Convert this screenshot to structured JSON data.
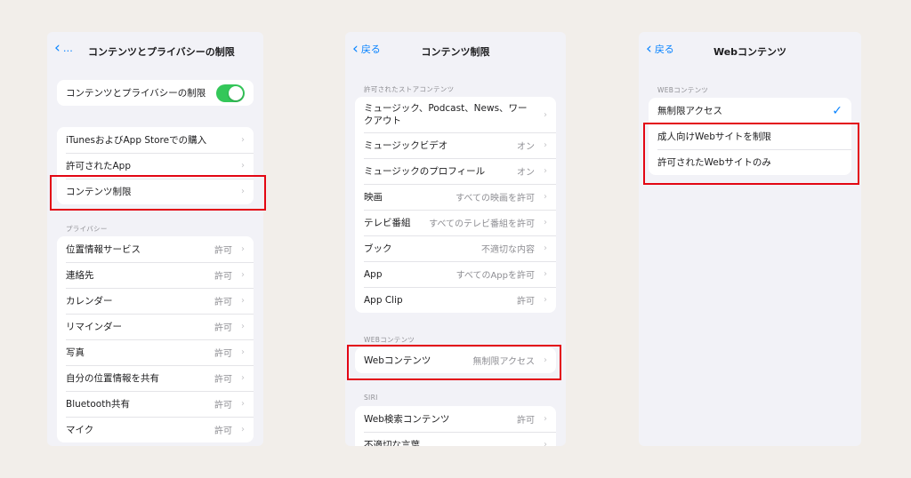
{
  "screen1": {
    "back_label": "…",
    "title": "コンテンツとプライバシーの制限",
    "toggle_row": {
      "label": "コンテンツとプライバシーの制限",
      "on": true
    },
    "group1": [
      {
        "label": "iTunesおよびApp Storeでの購入"
      },
      {
        "label": "許可されたApp"
      },
      {
        "label": "コンテンツ制限"
      }
    ],
    "privacy_header": "プライバシー",
    "privacy_rows": [
      {
        "label": "位置情報サービス",
        "value": "許可"
      },
      {
        "label": "連絡先",
        "value": "許可"
      },
      {
        "label": "カレンダー",
        "value": "許可"
      },
      {
        "label": "リマインダー",
        "value": "許可"
      },
      {
        "label": "写真",
        "value": "許可"
      },
      {
        "label": "自分の位置情報を共有",
        "value": "許可"
      },
      {
        "label": "Bluetooth共有",
        "value": "許可"
      },
      {
        "label": "マイク",
        "value": "許可"
      }
    ]
  },
  "screen2": {
    "back_label": "戻る",
    "title": "コンテンツ制限",
    "store_header": "許可されたストアコンテンツ",
    "store_rows": [
      {
        "label": "ミュージック、Podcast、News、ワークアウト",
        "value": ""
      },
      {
        "label": "ミュージックビデオ",
        "value": "オン"
      },
      {
        "label": "ミュージックのプロフィール",
        "value": "オン"
      },
      {
        "label": "映画",
        "value": "すべての映画を許可"
      },
      {
        "label": "テレビ番組",
        "value": "すべてのテレビ番組を許可"
      },
      {
        "label": "ブック",
        "value": "不適切な内容"
      },
      {
        "label": "App",
        "value": "すべてのAppを許可"
      },
      {
        "label": "App Clip",
        "value": "許可"
      }
    ],
    "web_header": "WEBコンテンツ",
    "web_row": {
      "label": "Webコンテンツ",
      "value": "無制限アクセス"
    },
    "siri_header": "SIRI",
    "siri_rows": [
      {
        "label": "Web検索コンテンツ",
        "value": "許可"
      },
      {
        "label": "不適切な言葉",
        "value": ""
      }
    ]
  },
  "screen3": {
    "back_label": "戻る",
    "title": "Webコンテンツ",
    "web_header": "WEBコンテンツ",
    "options": [
      {
        "label": "無制限アクセス",
        "selected": true
      },
      {
        "label": "成人向けWebサイトを制限",
        "selected": false
      },
      {
        "label": "許可されたWebサイトのみ",
        "selected": false
      }
    ]
  },
  "colors": {
    "accent": "#0a84ff",
    "highlight": "#e30613",
    "toggle_on": "#34c759"
  },
  "icons": {
    "back": "chevron-left-icon",
    "disclosure": "chevron-right-icon",
    "check": "checkmark-icon"
  }
}
